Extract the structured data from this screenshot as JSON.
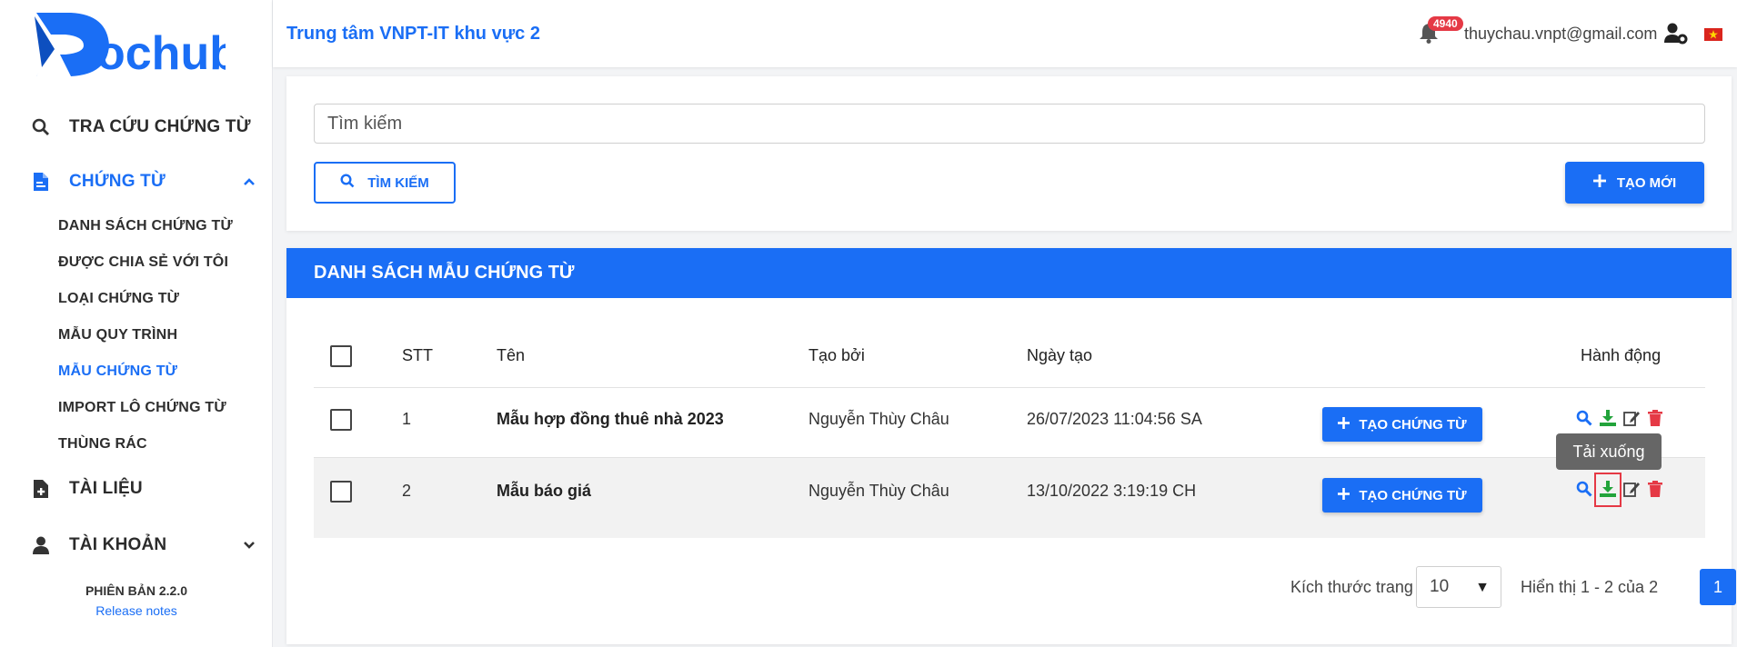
{
  "brand": {
    "logo_text": "ochub"
  },
  "colors": {
    "primary": "#1a6ef5",
    "danger": "#e53945",
    "success": "#22a33b"
  },
  "sidebar": {
    "items": [
      {
        "label": "TRA CỨU CHỨNG TỪ",
        "icon": "search-icon"
      },
      {
        "label": "CHỨNG TỪ",
        "icon": "file-icon"
      },
      {
        "label": "TÀI LIỆU",
        "icon": "file-plus-icon"
      },
      {
        "label": "TÀI KHOẢN",
        "icon": "user-icon"
      }
    ],
    "subitems": [
      "DANH SÁCH CHỨNG TỪ",
      "ĐƯỢC CHIA SẺ VỚI TÔI",
      "LOẠI CHỨNG TỪ",
      "MẪU QUY TRÌNH",
      "MẪU CHỨNG TỪ",
      "IMPORT LÔ CHỨNG TỪ",
      "THÙNG RÁC"
    ],
    "version": "PHIÊN BẢN 2.2.0",
    "release_notes": "Release notes"
  },
  "header": {
    "title": "Trung tâm VNPT-IT khu vực 2",
    "notification_count": "4940",
    "email": "thuychau.vnpt@gmail.com"
  },
  "search": {
    "placeholder": "Tìm kiếm",
    "search_button": "TÌM KIẾM",
    "create_button": "TẠO MỚI"
  },
  "list": {
    "title": "DANH SÁCH MẪU CHỨNG TỪ",
    "columns": {
      "stt": "STT",
      "name": "Tên",
      "created_by": "Tạo bởi",
      "created_at": "Ngày tạo",
      "actions": "Hành động"
    },
    "rows": [
      {
        "stt": "1",
        "name": "Mẫu hợp đồng thuê nhà 2023",
        "created_by": "Nguyễn Thùy Châu",
        "created_at": "26/07/2023 11:04:56 SA",
        "button": "TẠO CHỨNG TỪ"
      },
      {
        "stt": "2",
        "name": "Mẫu báo giá",
        "created_by": "Nguyễn Thùy Châu",
        "created_at": "13/10/2022 3:19:19 CH",
        "button": "TẠO CHỨNG TỪ"
      }
    ],
    "tooltip": "Tải xuống"
  },
  "pagination": {
    "page_size_label": "Kích thước trang",
    "page_size": "10",
    "summary": "Hiển thị 1 - 2 của 2",
    "current_page": "1"
  }
}
